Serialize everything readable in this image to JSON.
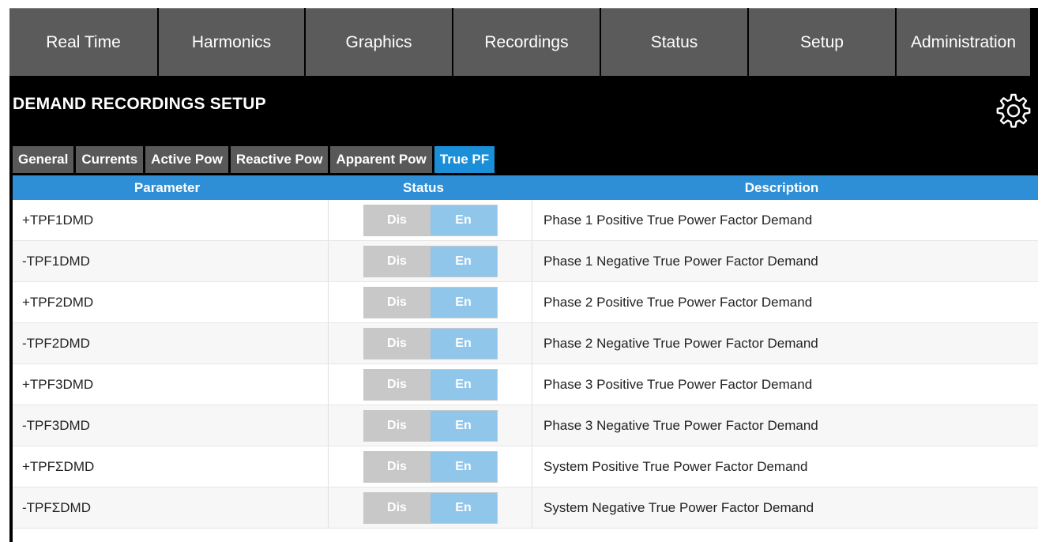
{
  "nav": {
    "items": [
      {
        "label": "Real Time"
      },
      {
        "label": "Harmonics"
      },
      {
        "label": "Graphics"
      },
      {
        "label": "Recordings"
      },
      {
        "label": "Status"
      },
      {
        "label": "Setup"
      },
      {
        "label": "Administration"
      }
    ]
  },
  "page": {
    "title": "DEMAND RECORDINGS SETUP",
    "settings_icon": "gear-icon"
  },
  "subtabs": [
    {
      "label": "General"
    },
    {
      "label": "Currents"
    },
    {
      "label": "Active Pow"
    },
    {
      "label": "Reactive Pow"
    },
    {
      "label": "Apparent Pow"
    },
    {
      "label": "True PF",
      "active": true
    }
  ],
  "table": {
    "headers": {
      "parameter": "Parameter",
      "status": "Status",
      "description": "Description"
    },
    "rows": [
      {
        "parameter": "+TPF1DMD",
        "dis": "Dis",
        "en": "En",
        "description": "Phase 1 Positive True Power Factor Demand"
      },
      {
        "parameter": "-TPF1DMD",
        "dis": "Dis",
        "en": "En",
        "description": "Phase 1 Negative True Power Factor Demand"
      },
      {
        "parameter": "+TPF2DMD",
        "dis": "Dis",
        "en": "En",
        "description": "Phase 2 Positive True Power Factor Demand"
      },
      {
        "parameter": "-TPF2DMD",
        "dis": "Dis",
        "en": "En",
        "description": "Phase 2 Negative True Power Factor Demand"
      },
      {
        "parameter": "+TPF3DMD",
        "dis": "Dis",
        "en": "En",
        "description": "Phase 3 Positive True Power Factor Demand"
      },
      {
        "parameter": "-TPF3DMD",
        "dis": "Dis",
        "en": "En",
        "description": "Phase 3 Negative True Power Factor Demand"
      },
      {
        "parameter": "+TPFΣDMD",
        "dis": "Dis",
        "en": "En",
        "description": "System Positive True Power Factor Demand"
      },
      {
        "parameter": "-TPFΣDMD",
        "dis": "Dis",
        "en": "En",
        "description": "System Negative True Power Factor Demand"
      }
    ]
  },
  "colors": {
    "accent": "#2e8fd6",
    "nav_bg": "#5b5b5b",
    "toggle_dis": "#c8c8c8",
    "toggle_en": "#8fc6ea"
  }
}
